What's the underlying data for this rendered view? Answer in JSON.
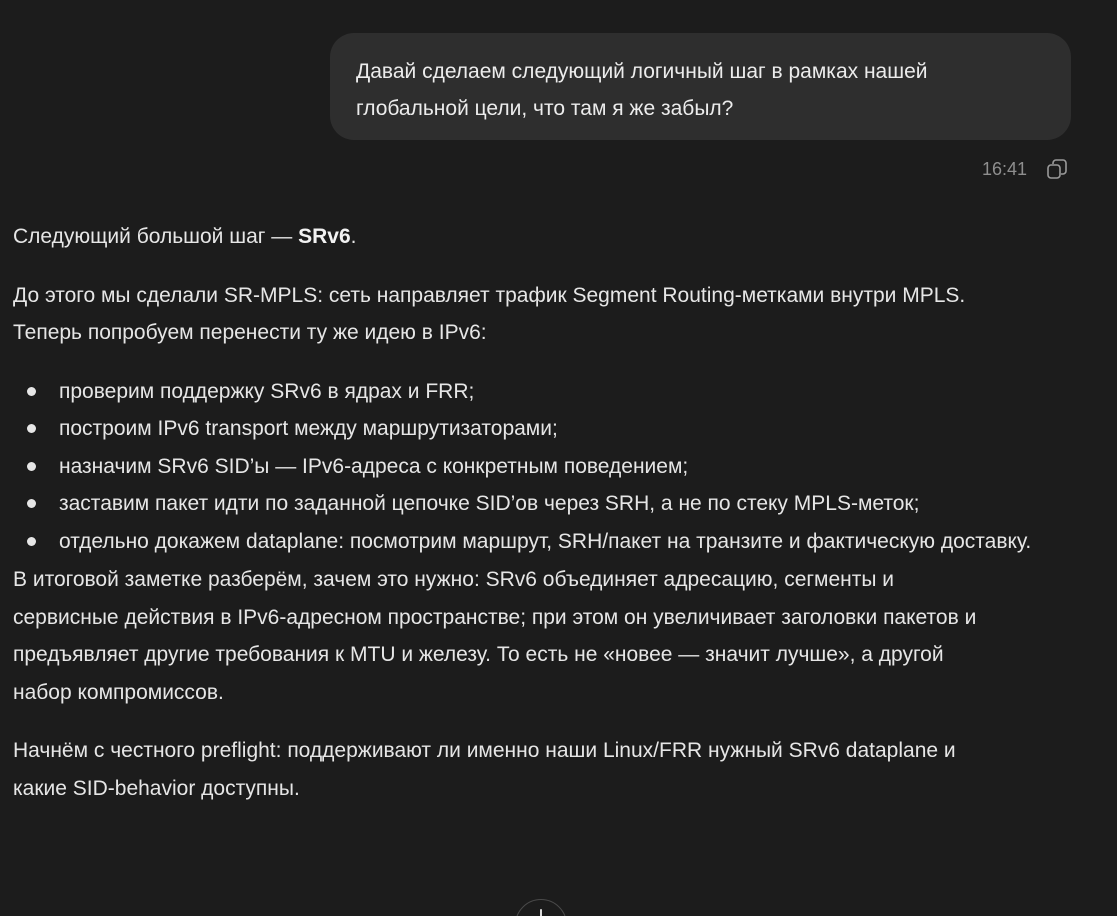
{
  "user_message": {
    "line1": "Давай сделаем следующий логичный шаг в рамках нашей",
    "line2": "глобальной цели, что там я же забыл?",
    "time": "16:41"
  },
  "icons": {
    "copy": "copy-icon",
    "scroll_down": "arrow-down-icon"
  },
  "assistant": {
    "p1_prefix": "Следующий большой шаг — ",
    "p1_bold": "SRv6",
    "p1_suffix": ".",
    "p2_line1": "До этого мы сделали SR-MPLS: сеть направляет трафик Segment Routing-метками внутри MPLS.",
    "p2_line2": "Теперь попробуем перенести ту же идею в IPv6:",
    "bullets": [
      "проверим поддержку SRv6 в ядрах и FRR;",
      "построим IPv6 transport между маршрутизаторами;",
      "назначим SRv6 SID’ы — IPv6-адреса с конкретным поведением;",
      "заставим пакет идти по заданной цепочке SID’ов через SRH, а не по стеку MPLS-меток;",
      "отдельно докажем dataplane: посмотрим маршрут, SRH/пакет на транзите и фактическую доставку."
    ],
    "p3_line1": "В итоговой заметке разберём, зачем это нужно: SRv6 объединяет адресацию, сегменты и",
    "p3_line2": "сервисные действия в IPv6-адресном пространстве; при этом он увеличивает заголовки пакетов и",
    "p3_line3": "предъявляет другие требования к MTU и железу. То есть не «новее — значит лучше», а другой",
    "p3_line4": "набор компромиссов.",
    "p4_line1": "Начнём с честного preflight: поддерживают ли именно наши Linux/FRR нужный SRv6 dataplane и",
    "p4_line2": "какие SID-behavior доступны."
  }
}
